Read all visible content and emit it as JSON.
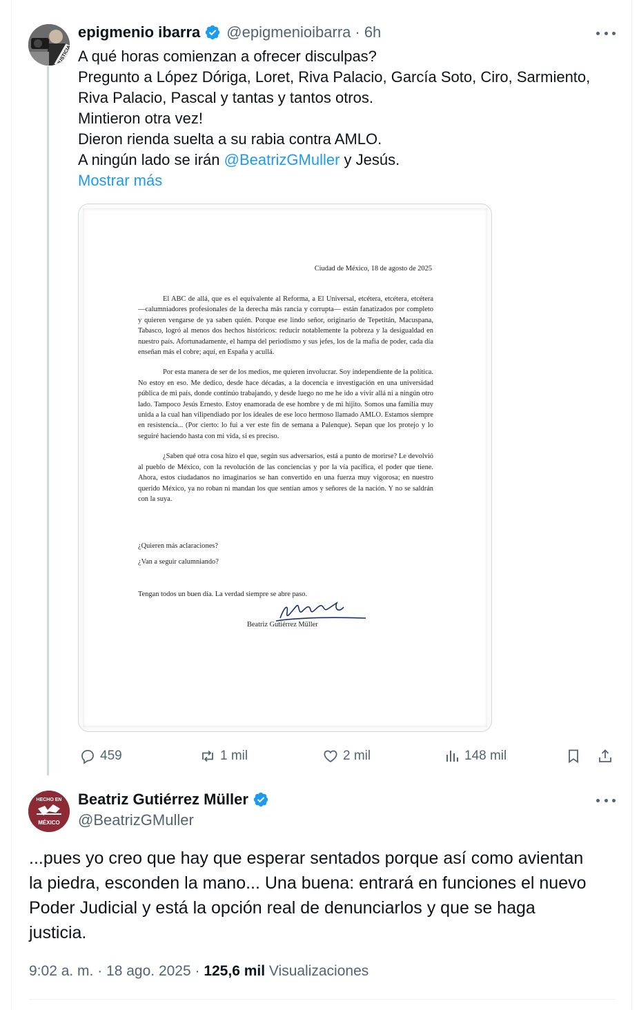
{
  "tweet1": {
    "display_name": "epigmenio ibarra",
    "handle": "@epigmenioibarra",
    "time": "· 6h",
    "lines": [
      "A qué horas comienzan a ofrecer disculpas?",
      "Pregunto a López Dóriga, Loret, Riva Palacio, García Soto, Ciro, Sarmiento,",
      "Riva Palacio, Pascal y tantas y tantos otros.",
      "Mintieron otra vez!",
      "Dieron rienda suelta a su rabia contra AMLO."
    ],
    "last_line_before": "A ningún lado se irán ",
    "mention": "@BeatrizGMuller",
    "last_line_after": " y Jesús.",
    "show_more": "Mostrar más",
    "avatar_text": "JUSTICIA",
    "document": {
      "date": "Ciudad de México, 18 de agosto de 2025",
      "paragraphs": [
        "El ABC de allá, que es el equivalente al Reforma, a El Universal, etcétera, etcétera, etcétera —calumniadores profesionales de la derecha más rancia y corrupta— están fanatizados por completo y quieren vengarse de ya saben quién. Porque ese lindo señor, originario de Tepetitán, Macuspana, Tabasco, logró al menos dos hechos históricos: reducir notablemente la pobreza y la desigualdad en nuestro país. Afortunadamente, el hampa del periodismo y sus jefes, los de la mafia de poder, cada día enseñan más el cobre; aquí, en España y acullá.",
        "Por esta manera de ser de los medios, me quieren involucrar. Soy independiente de la política. No estoy en eso. Me dedico, desde hace décadas, a la docencia e investigación en una universidad pública de mi país, donde continúo trabajando, y desde luego no me he ido a vivir allá ni a ningún otro lado. Tampoco Jesús Ernesto. Estoy enamorada de ese hombre y de mi hijito. Somos una familia muy unida a la cual han vilipendiado por los ideales de ese loco hermoso llamado AMLO. Estamos siempre en resistencia... (Por cierto: lo fui a ver este fin de semana a Palenque). Sepan que los protejo y lo seguiré haciendo hasta con mi vida, si es preciso.",
        "¿Saben qué otra cosa hizo el que, según sus adversarios, está a punto de morirse? Le devolvió al pueblo de México, con la revolución de las conciencias y por la vía pacífica, el poder que tiene. Ahora, estos ciudadanos no imaginarios se han convertido en una fuerza muy vigorosa; en nuestro querido México, ya no roban ni mandan los que sentían amos y señores de la nación. Y no se saldrán con la suya."
      ],
      "question1": "¿Quieren más aclaraciones?",
      "question2": "¿Van a seguir calumniando?",
      "closing": "Tengan todos un buen día. La verdad siempre se abre paso.",
      "signature_name": "Beatriz Gutiérrez Müller"
    },
    "actions": {
      "replies": "459",
      "reposts": "1 mil",
      "likes": "2 mil",
      "views": "148 mil"
    }
  },
  "tweet2": {
    "display_name": "Beatriz Gutiérrez Müller",
    "handle": "@BeatrizGMuller",
    "avatar_text_top": "HECHO EN",
    "avatar_text_bottom": "MÉXICO",
    "lines": [
      "...pues yo creo que hay que esperar sentados porque así como avientan",
      "la piedra, esconden la mano... Una buena: entrará en funciones el nuevo",
      "Poder Judicial y está la opción real de denunciarlos y que se haga",
      "justicia."
    ],
    "time": "9:02 a. m. · 18 ago. 2025 · ",
    "views_count": "125,6 mil",
    "views_label": " Visualizaciones"
  },
  "colors": {
    "accent": "#1d9bf0",
    "secondary_text": "#536471",
    "avatar2_bg": "#8c2a35"
  }
}
